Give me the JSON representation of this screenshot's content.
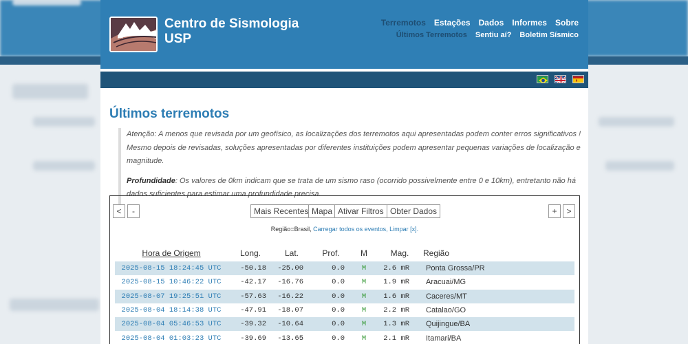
{
  "site": {
    "title_line1": "Centro de Sismologia",
    "title_line2": "USP"
  },
  "nav_primary": [
    "Terremotos",
    "Estações",
    "Dados",
    "Informes",
    "Sobre"
  ],
  "nav_secondary": [
    "Últimos Terremotos",
    "Sentiu aí?",
    "Boletim Sísmico"
  ],
  "flags": [
    "flag-brazil-icon",
    "flag-uk-icon",
    "flag-spain-icon"
  ],
  "page_title": "Últimos terremotos",
  "notice": {
    "attention": "Atenção: A menos que revisada por um geofísico, as localizações dos terremotos aqui apresentadas podem conter erros significativos ! Mesmo depois de revisadas, soluções apresentadas por diferentes instituições podem apresentar pequenas variações de localização e magnitude.",
    "depth_label": "Profundidade",
    "depth_text": ": Os valores de 0km indicam que se trata de um sismo raso (ocorrido possivelmente entre 0 e 10km), entretanto não há dados suficientes para estimar uma profundidade precisa."
  },
  "controls": {
    "prev": "<",
    "minus": "-",
    "plus": "+",
    "next": ">",
    "recent": "Mais Recentes",
    "map": "Mapa",
    "filters": "Ativar Filtros",
    "data": "Obter Dados"
  },
  "filter": {
    "region": "Região=Brasil,",
    "load_all": "Carregar todos os eventos,",
    "clear": "Limpar [x]."
  },
  "table": {
    "headers": [
      "Hora de Origem",
      "Long.",
      "Lat.",
      "Prof.",
      "M",
      "Mag.",
      "Região"
    ],
    "rows": [
      [
        "2025-08-15 18:24:45 UTC",
        "-50.18",
        "-25.00",
        "0.0",
        "M",
        "2.6 mR",
        "Ponta Grossa/PR"
      ],
      [
        "2025-08-15 10:46:22 UTC",
        "-42.17",
        "-16.76",
        "0.0",
        "M",
        "1.9 mR",
        "Aracuai/MG"
      ],
      [
        "2025-08-07 19:25:51 UTC",
        "-57.63",
        "-16.22",
        "0.0",
        "M",
        "1.6 mR",
        "Caceres/MT"
      ],
      [
        "2025-08-04 18:14:38 UTC",
        "-47.91",
        "-18.07",
        "0.0",
        "M",
        "2.2 mR",
        "Catalao/GO"
      ],
      [
        "2025-08-04 05:46:53 UTC",
        "-39.32",
        "-10.64",
        "0.0",
        "M",
        "1.3 mR",
        "Quijingue/BA"
      ],
      [
        "2025-08-04 01:03:23 UTC",
        "-39.69",
        "-13.65",
        "0.0",
        "M",
        "2.1 mR",
        "Itamari/BA"
      ]
    ]
  }
}
